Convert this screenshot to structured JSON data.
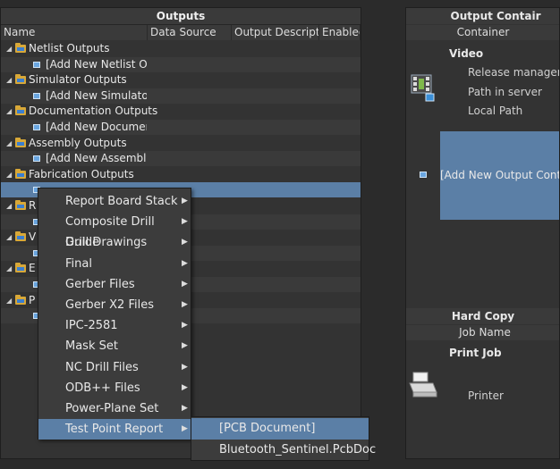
{
  "outputs_panel": {
    "title": "Outputs",
    "columns": [
      "Name",
      "Data Source",
      "Output Descripti...",
      "Enabled"
    ],
    "tree": [
      {
        "kind": "group",
        "label": "Netlist Outputs"
      },
      {
        "kind": "item",
        "label": "[Add New Netlist Outpu"
      },
      {
        "kind": "group",
        "label": "Simulator Outputs"
      },
      {
        "kind": "item",
        "label": "[Add New Simulator Ou"
      },
      {
        "kind": "group",
        "label": "Documentation Outputs"
      },
      {
        "kind": "item",
        "label": "[Add New Documentati"
      },
      {
        "kind": "group",
        "label": "Assembly Outputs"
      },
      {
        "kind": "item",
        "label": "[Add New Assembly Ou"
      },
      {
        "kind": "group",
        "label": "Fabrication Outputs"
      },
      {
        "kind": "item",
        "label": ""
      },
      {
        "kind": "group",
        "label": "R"
      },
      {
        "kind": "item",
        "label": ""
      },
      {
        "kind": "group",
        "label": "V"
      },
      {
        "kind": "item",
        "label": ""
      },
      {
        "kind": "group",
        "label": "E"
      },
      {
        "kind": "item",
        "label": ""
      },
      {
        "kind": "group",
        "label": "P"
      },
      {
        "kind": "item",
        "label": ""
      }
    ]
  },
  "containers_panel": {
    "title": "Output Contair",
    "column": "Container",
    "video": {
      "heading": "Video",
      "fields": [
        "Release management",
        "Path in server",
        "Local Path"
      ]
    },
    "add_new": "[Add New Output Containe",
    "hardcopy_title": "Hard Copy",
    "hardcopy_column": "Job Name",
    "print_job": {
      "heading": "Print Job",
      "field": "Printer"
    }
  },
  "context_menu": {
    "items": [
      {
        "label": "Report Board Stack"
      },
      {
        "label": "Composite Drill Guide"
      },
      {
        "label": "Drill Drawings"
      },
      {
        "label": "Final"
      },
      {
        "label": "Gerber Files"
      },
      {
        "label": "Gerber X2 Files"
      },
      {
        "label": "IPC-2581"
      },
      {
        "label": "Mask Set"
      },
      {
        "label": "NC Drill Files"
      },
      {
        "label": "ODB++ Files"
      },
      {
        "label": "Power-Plane Set"
      },
      {
        "label": "Test Point Report"
      }
    ],
    "highlighted_index": 11
  },
  "submenu": {
    "items": [
      "[PCB Document]",
      "Bluetooth_Sentinel.PcbDoc"
    ]
  },
  "colors": {
    "selection": "#5b7fa6",
    "panel": "#333333",
    "background": "#2b2b2b"
  }
}
